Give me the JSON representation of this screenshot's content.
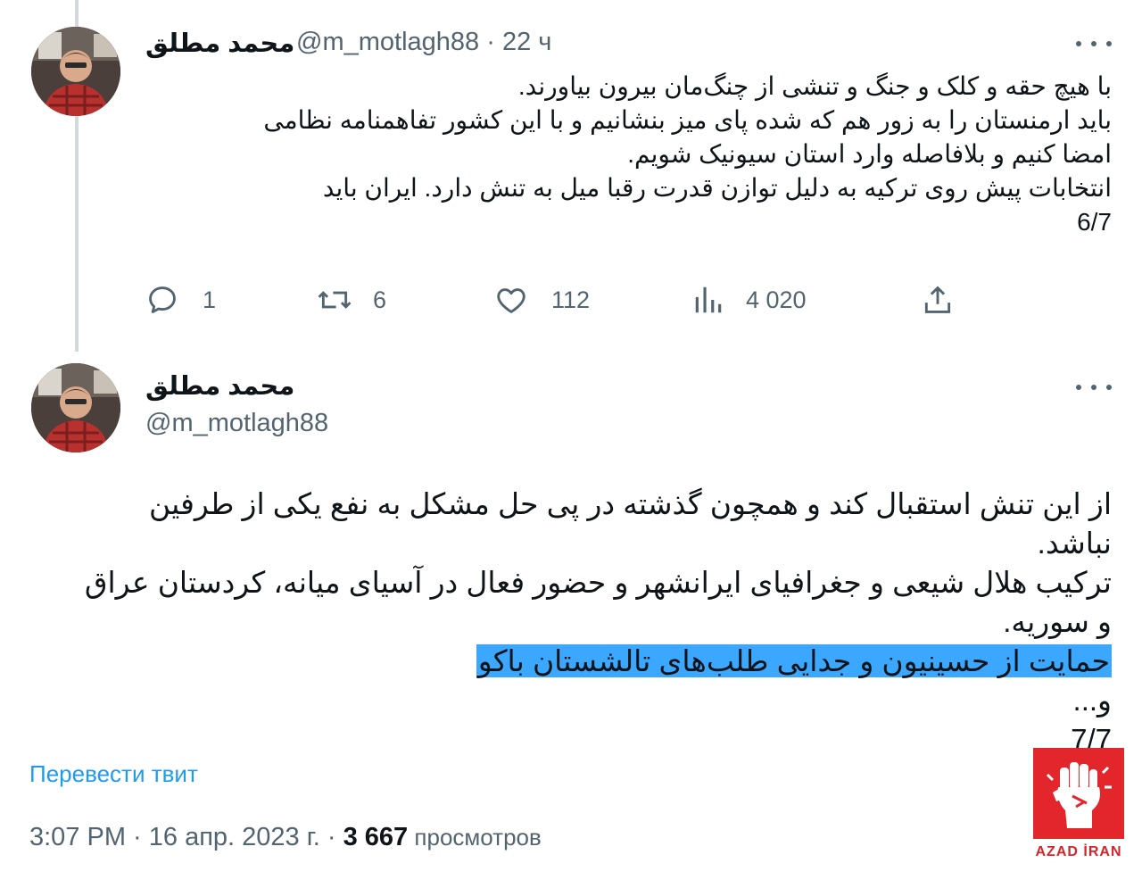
{
  "tweets": [
    {
      "author": {
        "display_name": "محمد مطلق",
        "handle": "@m_motlagh88",
        "time_ago": "22 ч",
        "separator": " · "
      },
      "text_lines": [
        "با هیچ حقه و کلک و جنگ و تنشی از چنگ‌مان بیرون بیاورند.",
        "باید ارمنستان را به زور هم که شده پای میز بنشانیم و با این کشور تفاهمنامه نظامی",
        "امضا کنیم و بلافاصله وارد استان سیونیک شویم.",
        "انتخابات پیش روی ترکیه به دلیل توازن قدرت رقبا میل به تنش دارد. ایران باید",
        "6/7"
      ],
      "actions": {
        "reply": {
          "icon": "reply-icon",
          "count": "1"
        },
        "retweet": {
          "icon": "retweet-icon",
          "count": "6"
        },
        "like": {
          "icon": "heart-icon",
          "count": "112"
        },
        "views": {
          "icon": "views-icon",
          "count": "4 020"
        },
        "share": {
          "icon": "share-icon"
        }
      }
    },
    {
      "author": {
        "display_name": "محمد مطلق",
        "handle": "@m_motlagh88"
      },
      "text_lines": [
        "از این تنش استقبال کند و همچون گذشته در پی حل مشکل به نفع یکی از طرفین",
        "نباشد.",
        "ترکیب هلال شیعی و جغرافیای ایرانشهر و حضور فعال در آسیای میانه، کردستان عراق",
        "و سوریه.",
        "حمایت از حسینیون و جدایی طلب‌های تالشستان باکو",
        "و...",
        "7/7"
      ],
      "highlighted_line_index": 4,
      "translate_label": "Перевести твит",
      "timestamp": "3:07 PM · 16 апр. 2023 г.",
      "dot": " · ",
      "views_count": "3 667",
      "views_label": " просмотров"
    }
  ],
  "colors": {
    "text": "#0f1419",
    "secondary": "#536471",
    "link": "#1d9bf0",
    "highlight": "#3ca7ff",
    "thread_line": "#cfd9de",
    "watermark_red": "#e3252c"
  },
  "watermark": {
    "logo": "raised-fist-logo",
    "text": "AZAD İRAN"
  }
}
